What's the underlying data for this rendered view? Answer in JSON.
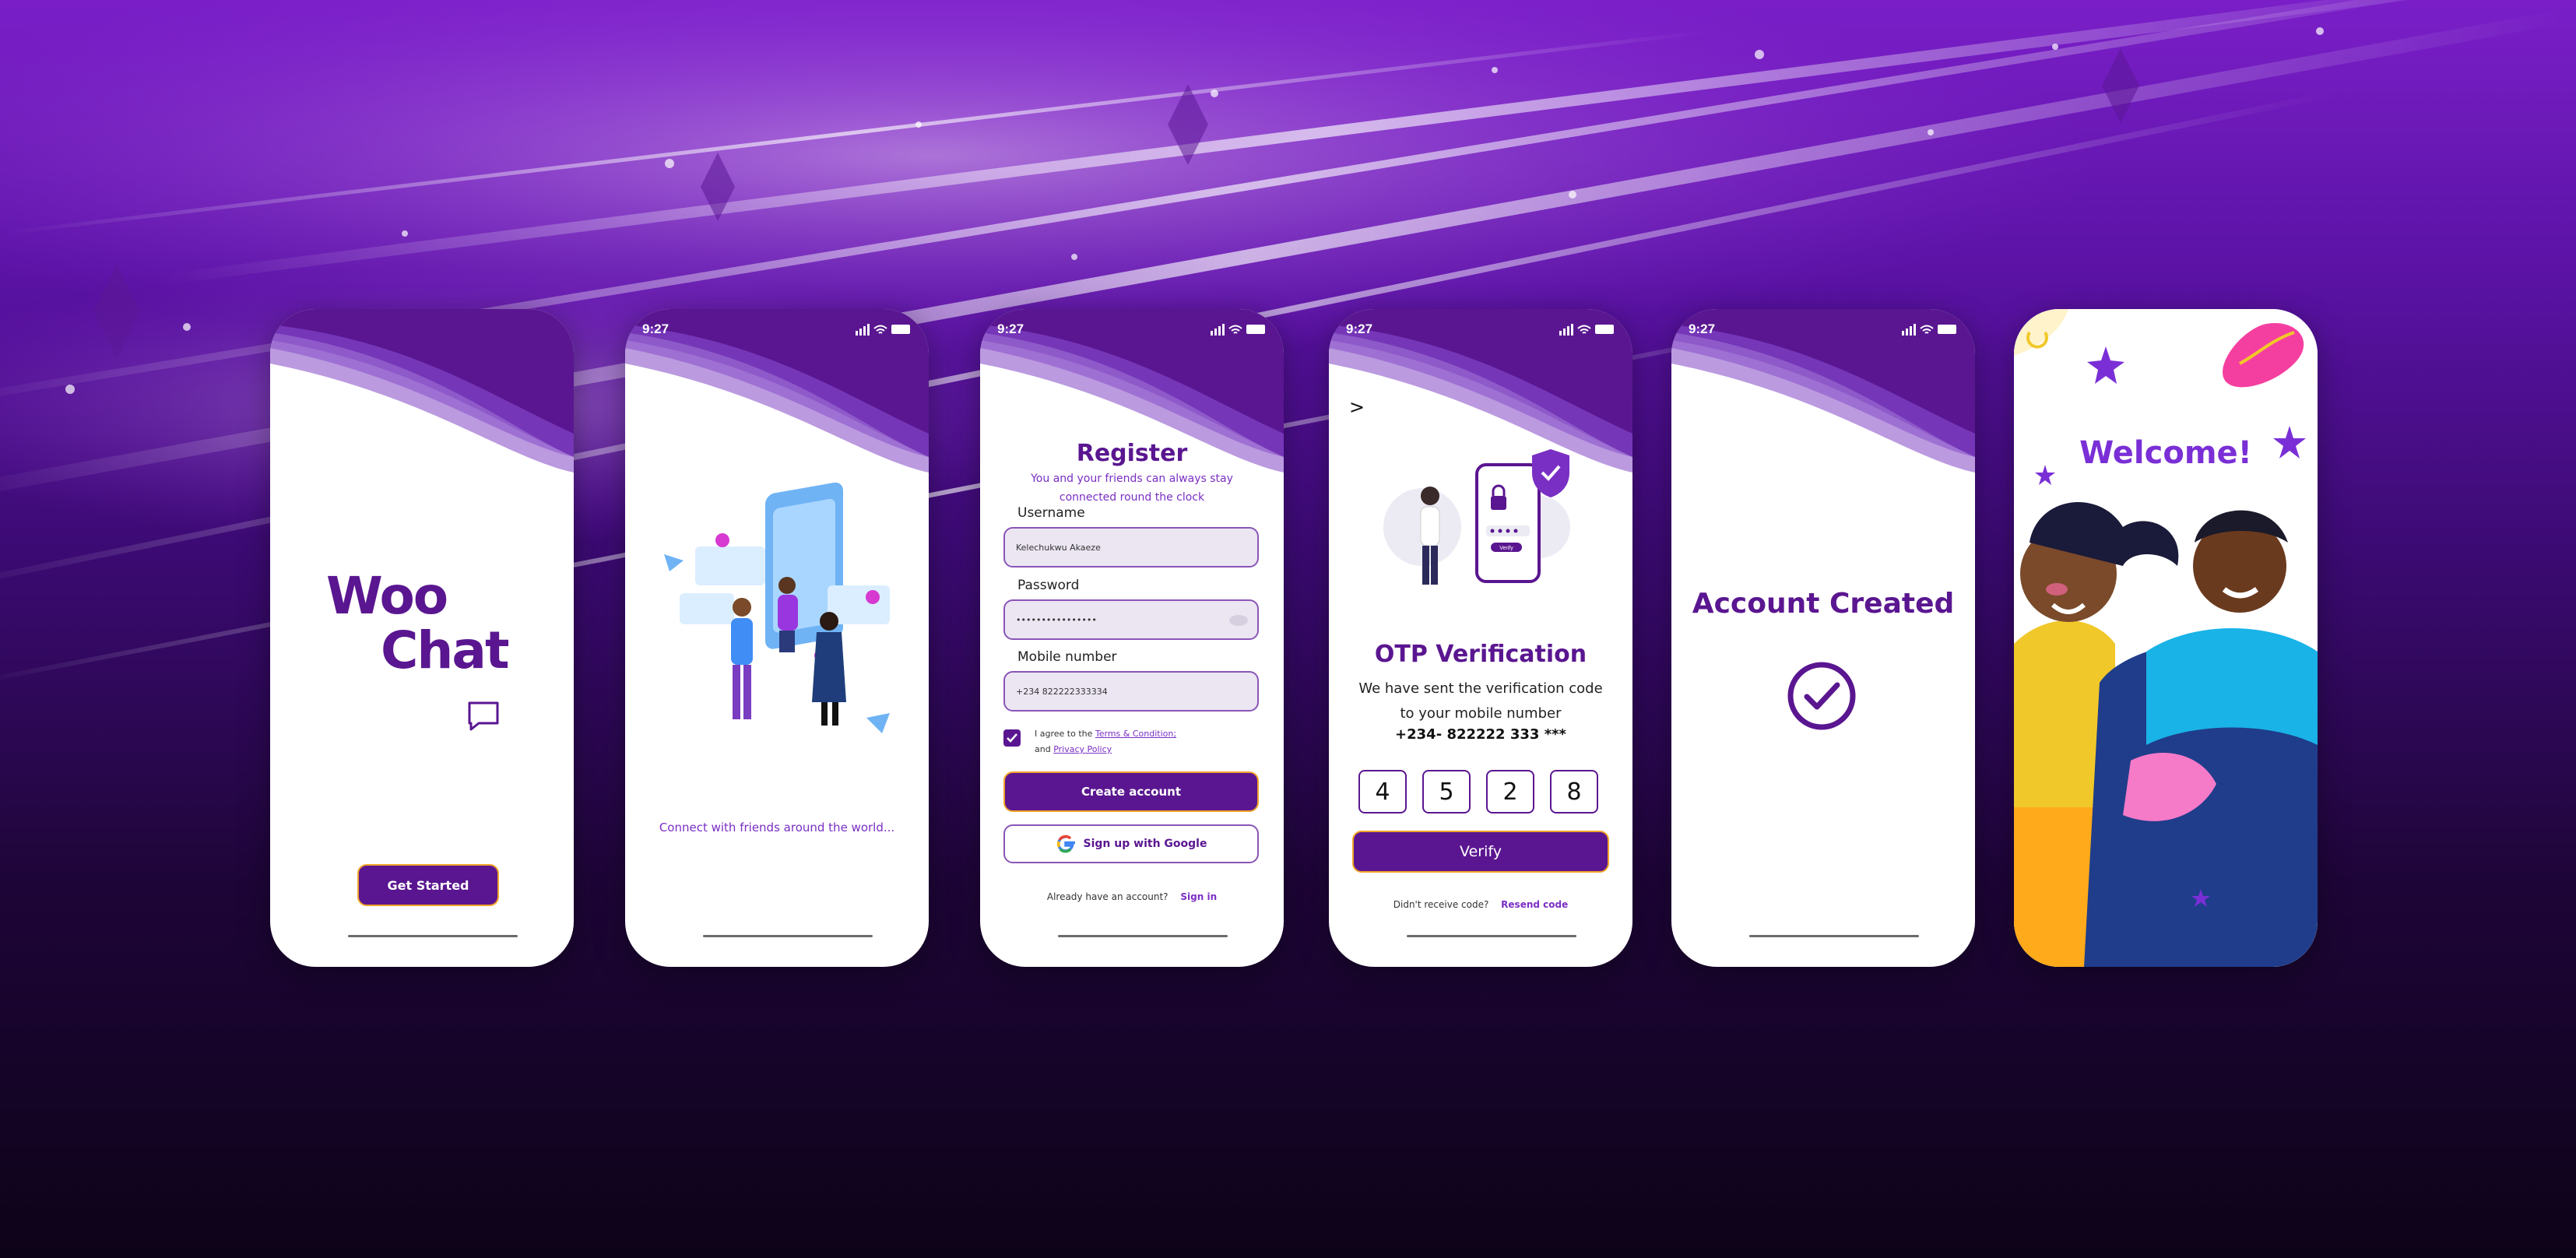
{
  "screens": {
    "splash": {
      "logo_woo": "Woo",
      "logo_chat": "Chat",
      "get_started_label": "Get Started"
    },
    "onboarding": {
      "status_time": "9:27",
      "tagline": "Connect with friends around the world..."
    },
    "register": {
      "status_time": "9:27",
      "title": "Register",
      "subtitle": "You and your friends can always stay connected round the clock",
      "username_label": "Username",
      "username_value": "Kelechukwu Akaeze",
      "password_label": "Password",
      "password_value": "••••••••••••••••",
      "mobile_label": "Mobile number",
      "mobile_value": "+234 822222333334",
      "agree_prefix": "I agree to the",
      "terms_link": "Terms & Condition;",
      "agree_and": "and",
      "privacy_link": "Privacy Policy",
      "create_account_label": "Create account",
      "google_label": "Sign up with Google",
      "have_account_text": "Already have an account?",
      "sign_in_label": "Sign in"
    },
    "otp": {
      "status_time": "9:27",
      "back_glyph": ">",
      "title": "OTP Verification",
      "subtitle_line1": "We have sent the verification code",
      "subtitle_line2": "to your mobile number",
      "phone": "+234- 822222 333 ***",
      "digits": [
        "4",
        "5",
        "2",
        "8"
      ],
      "verify_label": "Verify",
      "illustration_verify_label": "Verify",
      "didnt_receive": "Didn't receive code?",
      "resend_label": "Resend code"
    },
    "account_created": {
      "status_time": "9:27",
      "title": "Account Created"
    },
    "welcome": {
      "title": "Welcome!"
    }
  },
  "colors": {
    "brand_purple": "#5a1690",
    "accent_purple": "#7a2fc4",
    "button_border": "#f1a42a",
    "background_top": "#7a1fc8",
    "background_bottom": "#0d0318"
  },
  "icons": [
    "signal-icon",
    "wifi-icon",
    "battery-icon",
    "chat-bubble-icon",
    "eye-icon",
    "google-icon",
    "check-circle-icon",
    "shield-lock-icon"
  ]
}
